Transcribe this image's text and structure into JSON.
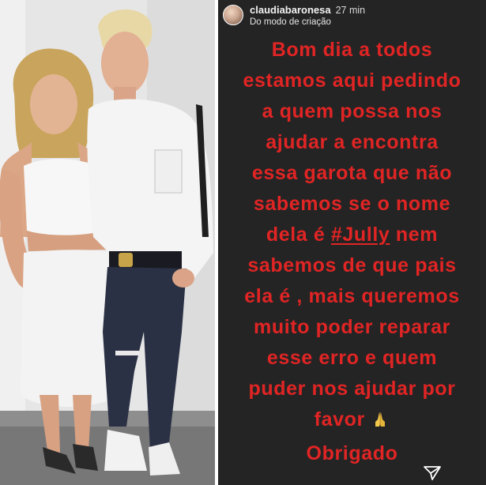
{
  "story": {
    "username": "claudiabaronesa",
    "time_ago": "27 min",
    "subtitle": "Do modo de criação",
    "lines": [
      "Bom dia a todos",
      "estamos aqui pedindo",
      "a quem possa nos",
      "ajudar a encontra",
      "essa garota que não",
      "sabemos se o nome",
      "dela é",
      "nem",
      "sabemos de que pais",
      "ela é , mais queremos",
      "muito poder reparar",
      "esse erro e quem",
      "puder nos ajudar por",
      "favor",
      "Obrigado"
    ],
    "hashtag": "#Jully",
    "text_color": "#e12424",
    "background": "#242424"
  },
  "icons": {
    "pray": "folded-hands-icon",
    "send": "send-icon",
    "avatar": "avatar"
  }
}
